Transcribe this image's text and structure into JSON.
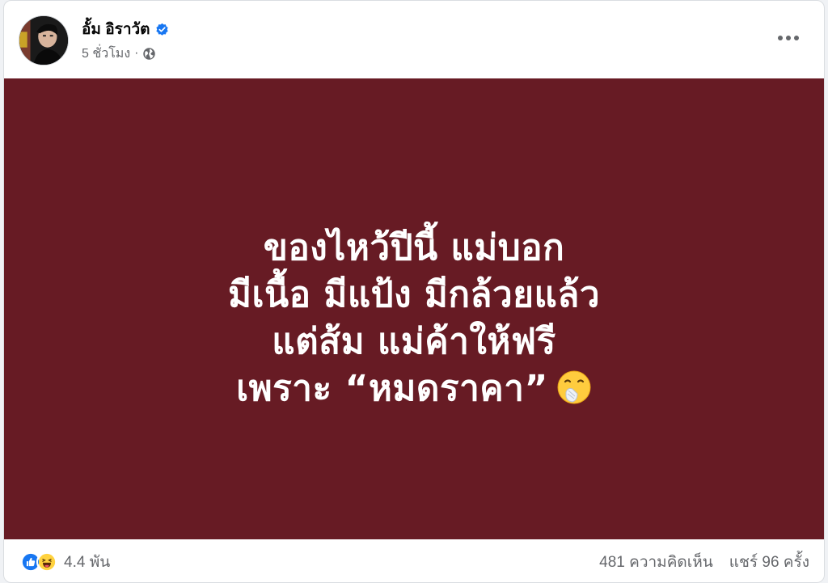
{
  "post": {
    "author": "อั้ม อิราวัต",
    "timestamp": "5 ชั่วโมง",
    "separator": "·",
    "privacy_icon": "globe-icon",
    "verified_icon": "verified-badge-icon",
    "more_icon": "more-options-icon"
  },
  "image_text": {
    "lines": [
      "ของไหว้ปีนี้ แม่บอก",
      "มีเนื้อ มีแป้ง มีกล้วยแล้ว",
      "แต่ส้ม แม่ค้าให้ฟรี",
      "เพราะ “หมดราคา”"
    ],
    "emoji": "hand-over-mouth-emoji",
    "background_color": "#671b24"
  },
  "footer": {
    "reaction_icons": [
      "like-icon",
      "haha-icon"
    ],
    "reaction_count": "4.4 พัน",
    "comments": "481 ความคิดเห็น",
    "shares": "แชร์ 96 ครั้ง"
  },
  "colors": {
    "accent_blue": "#1877f2",
    "secondary_text": "#65676b"
  }
}
